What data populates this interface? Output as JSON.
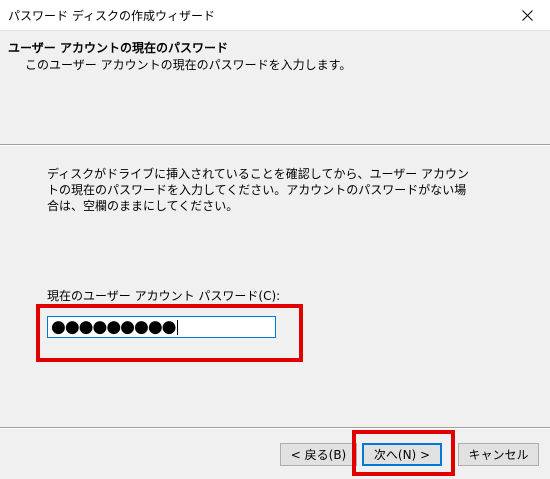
{
  "window": {
    "title": "パスワード ディスクの作成ウィザード",
    "close_icon": "close-icon"
  },
  "header": {
    "title": "ユーザー アカウントの現在のパスワード",
    "subtitle": "このユーザー アカウントの現在のパスワードを入力します。"
  },
  "body": {
    "instructions": "ディスクがドライブに挿入されていることを確認してから、ユーザー アカウントの現在のパスワードを入力してください。アカウントのパスワードがない場合は、空欄のままにしてください。",
    "password_label": "現在のユーザー アカウント パスワード(C):",
    "password_value": "●●●●●●●●●"
  },
  "buttons": {
    "back": "< 戻る(B)",
    "next": "次へ(N) >",
    "cancel": "キャンセル"
  },
  "colors": {
    "highlight": "#e00000",
    "focus": "#0078d7"
  }
}
